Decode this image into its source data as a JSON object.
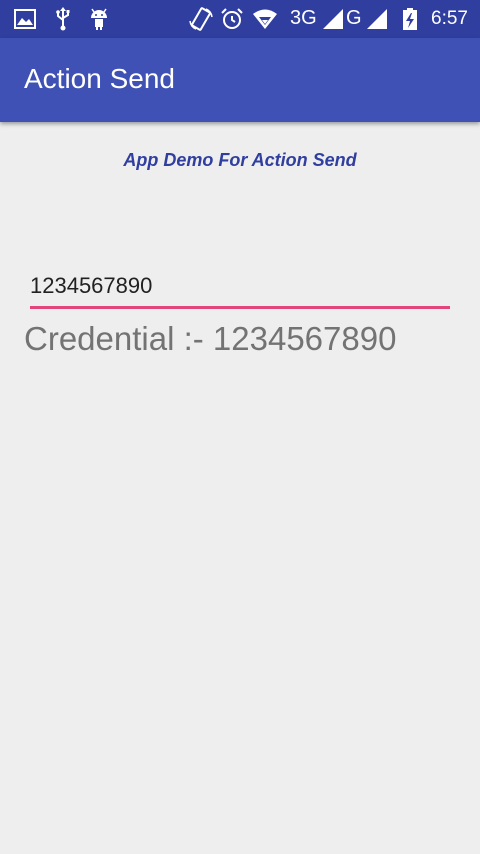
{
  "status_bar": {
    "left_icons": [
      "image-icon",
      "usb-icon",
      "android-debug-icon"
    ],
    "right_icons": [
      "rotation-icon",
      "alarm-icon",
      "wifi-icon",
      "signal-icon",
      "battery-charging-icon"
    ],
    "network_1": "3G",
    "network_2": "G",
    "time": "6:57"
  },
  "app_bar": {
    "title": "Action Send"
  },
  "main": {
    "subtitle": "App Demo For Action Send",
    "input_value": "1234567890",
    "credential_text": "Credential :- 1234567890"
  },
  "colors": {
    "status_bar": "#303F9F",
    "app_bar": "#3F51B5",
    "accent": "#E0457B",
    "background": "#EEEEEE",
    "subtitle": "#303F9F"
  }
}
